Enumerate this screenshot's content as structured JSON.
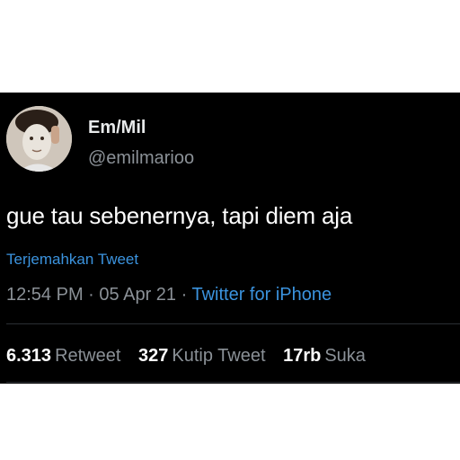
{
  "author": {
    "display_name": "Em/Mil",
    "handle": "@emilmarioo",
    "avatar_icon": "profile-photo"
  },
  "tweet": {
    "text": "gue tau sebenernya, tapi diem aja",
    "translate_label": "Terjemahkan Tweet",
    "time": "12:54 PM",
    "separator": "·",
    "date": "05 Apr 21",
    "source": "Twitter for iPhone"
  },
  "stats": {
    "retweets": {
      "count": "6.313",
      "label": "Retweet"
    },
    "quotes": {
      "count": "327",
      "label": "Kutip Tweet"
    },
    "likes": {
      "count": "17rb",
      "label": "Suka"
    }
  },
  "colors": {
    "background": "#000000",
    "link": "#3b93de",
    "secondary_text": "#8b9197"
  }
}
